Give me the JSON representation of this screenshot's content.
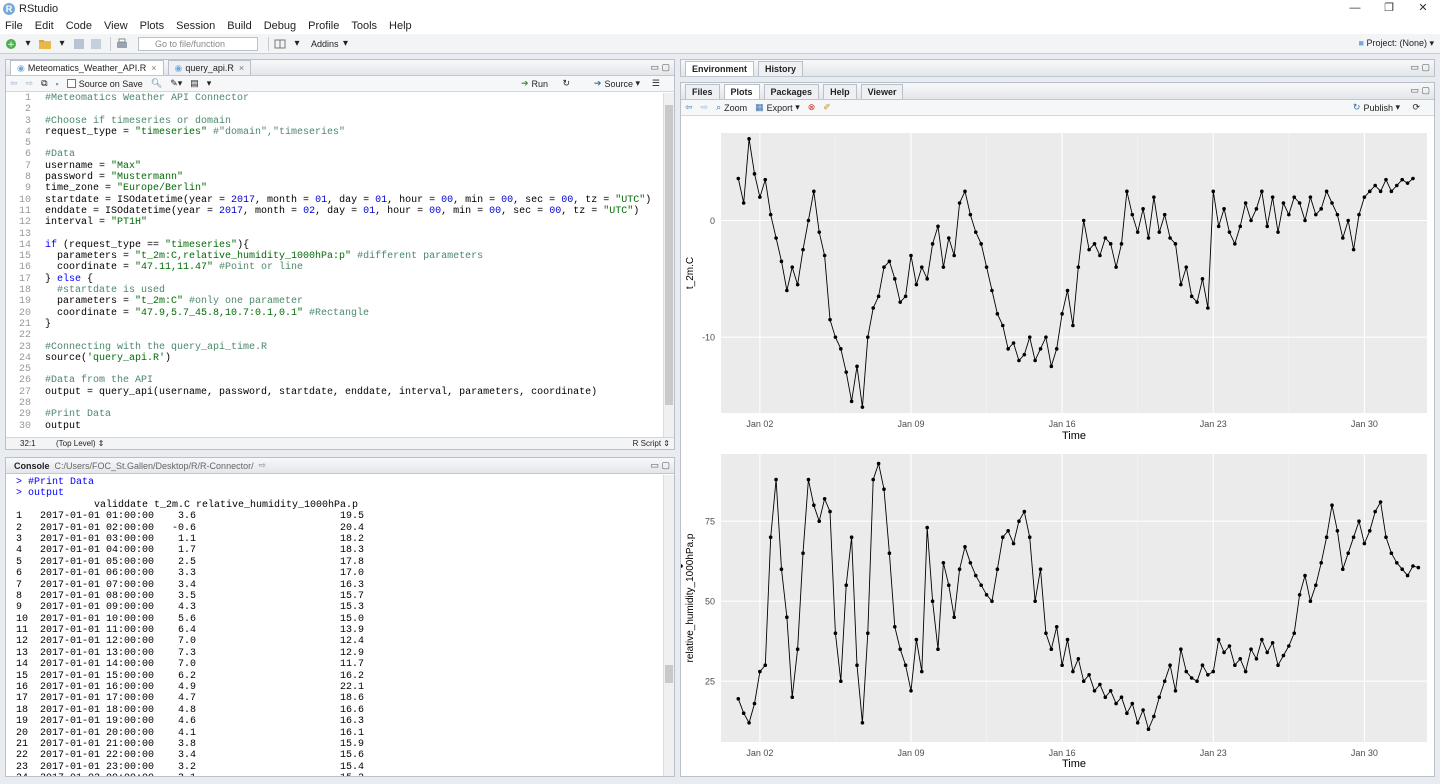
{
  "app": {
    "title": "RStudio",
    "icon_letter": "R"
  },
  "window_controls": {
    "minimize": "—",
    "maximize": "❐",
    "close": "✕"
  },
  "menu": [
    "File",
    "Edit",
    "Code",
    "View",
    "Plots",
    "Session",
    "Build",
    "Debug",
    "Profile",
    "Tools",
    "Help"
  ],
  "toolbar": {
    "goto_placeholder": "Go to file/function",
    "addins": "Addins",
    "project": "Project: (None)"
  },
  "editor": {
    "tabs": [
      "Meteomatics_Weather_API.R",
      "query_api.R"
    ],
    "source_on_save": "Source on Save",
    "run": "Run",
    "source": "Source",
    "status_pos": "32:1",
    "status_scope": "(Top Level)",
    "status_type": "R Script",
    "lines": [
      [
        [
          "c",
          "#Meteomatics Weather API Connector"
        ]
      ],
      [],
      [
        [
          "c",
          "#Choose if timeseries or domain"
        ]
      ],
      [
        [
          "p",
          "request_type = "
        ],
        [
          "s",
          "\"timeseries\""
        ],
        [
          "c",
          " #\"domain\",\"timeseries\""
        ]
      ],
      [],
      [
        [
          "c",
          "#Data"
        ]
      ],
      [
        [
          "p",
          "username = "
        ],
        [
          "s",
          "\"Max\""
        ]
      ],
      [
        [
          "p",
          "password = "
        ],
        [
          "s",
          "\"Mustermann\""
        ]
      ],
      [
        [
          "p",
          "time_zone = "
        ],
        [
          "s",
          "\"Europe/Berlin\""
        ]
      ],
      [
        [
          "p",
          "startdate = ISOdatetime(year = "
        ],
        [
          "n",
          "2017"
        ],
        [
          "p",
          ", month = "
        ],
        [
          "n",
          "01"
        ],
        [
          "p",
          ", day = "
        ],
        [
          "n",
          "01"
        ],
        [
          "p",
          ", hour = "
        ],
        [
          "n",
          "00"
        ],
        [
          "p",
          ", min = "
        ],
        [
          "n",
          "00"
        ],
        [
          "p",
          ", sec = "
        ],
        [
          "n",
          "00"
        ],
        [
          "p",
          ", tz = "
        ],
        [
          "s",
          "\"UTC\""
        ],
        [
          "p",
          ")"
        ]
      ],
      [
        [
          "p",
          "enddate = ISOdatetime(year = "
        ],
        [
          "n",
          "2017"
        ],
        [
          "p",
          ", month = "
        ],
        [
          "n",
          "02"
        ],
        [
          "p",
          ", day = "
        ],
        [
          "n",
          "01"
        ],
        [
          "p",
          ", hour = "
        ],
        [
          "n",
          "00"
        ],
        [
          "p",
          ", min = "
        ],
        [
          "n",
          "00"
        ],
        [
          "p",
          ", sec = "
        ],
        [
          "n",
          "00"
        ],
        [
          "p",
          ", tz = "
        ],
        [
          "s",
          "\"UTC\""
        ],
        [
          "p",
          ")"
        ]
      ],
      [
        [
          "p",
          "interval = "
        ],
        [
          "s",
          "\"PT1H\""
        ]
      ],
      [],
      [
        [
          "k",
          "if"
        ],
        [
          "p",
          " (request_type == "
        ],
        [
          "s",
          "\"timeseries\""
        ],
        [
          "p",
          "){"
        ]
      ],
      [
        [
          "p",
          "  parameters = "
        ],
        [
          "s",
          "\"t_2m:C,relative_humidity_1000hPa:p\""
        ],
        [
          "c",
          " #different parameters"
        ]
      ],
      [
        [
          "p",
          "  coordinate = "
        ],
        [
          "s",
          "\"47.11,11.47\""
        ],
        [
          "c",
          " #Point or line"
        ]
      ],
      [
        [
          "p",
          "} "
        ],
        [
          "k",
          "else"
        ],
        [
          "p",
          " {"
        ]
      ],
      [
        [
          "c",
          "  #startdate is used"
        ]
      ],
      [
        [
          "p",
          "  parameters = "
        ],
        [
          "s",
          "\"t_2m:C\""
        ],
        [
          "c",
          " #only one parameter"
        ]
      ],
      [
        [
          "p",
          "  coordinate = "
        ],
        [
          "s",
          "\"47.9,5.7_45.8,10.7:0.1,0.1\""
        ],
        [
          "c",
          " #Rectangle"
        ]
      ],
      [
        [
          "p",
          "}"
        ]
      ],
      [],
      [
        [
          "c",
          "#Connecting with the query_api_time.R"
        ]
      ],
      [
        [
          "p",
          "source("
        ],
        [
          "s",
          "'query_api.R'"
        ],
        [
          "p",
          ")"
        ]
      ],
      [],
      [
        [
          "c",
          "#Data from the API"
        ]
      ],
      [
        [
          "p",
          "output = query_api(username, password, startdate, enddate, interval, parameters, coordinate)"
        ]
      ],
      [],
      [
        [
          "c",
          "#Print Data"
        ]
      ],
      [
        [
          "p",
          "output"
        ]
      ]
    ]
  },
  "console": {
    "title": "Console",
    "path": "C:/Users/FOC_St.Gallen/Desktop/R/R-Connector/",
    "lines": [
      {
        "t": "> #Print Data",
        "cmd": true
      },
      {
        "t": "> output",
        "cmd": true
      },
      {
        "t": "             validdate t_2m.C relative_humidity_1000hPa.p"
      },
      {
        "t": "1   2017-01-01 01:00:00    3.6                        19.5"
      },
      {
        "t": "2   2017-01-01 02:00:00   -0.6                        20.4"
      },
      {
        "t": "3   2017-01-01 03:00:00    1.1                        18.2"
      },
      {
        "t": "4   2017-01-01 04:00:00    1.7                        18.3"
      },
      {
        "t": "5   2017-01-01 05:00:00    2.5                        17.8"
      },
      {
        "t": "6   2017-01-01 06:00:00    3.3                        17.0"
      },
      {
        "t": "7   2017-01-01 07:00:00    3.4                        16.3"
      },
      {
        "t": "8   2017-01-01 08:00:00    3.5                        15.7"
      },
      {
        "t": "9   2017-01-01 09:00:00    4.3                        15.3"
      },
      {
        "t": "10  2017-01-01 10:00:00    5.6                        15.0"
      },
      {
        "t": "11  2017-01-01 11:00:00    6.4                        13.9"
      },
      {
        "t": "12  2017-01-01 12:00:00    7.0                        12.4"
      },
      {
        "t": "13  2017-01-01 13:00:00    7.3                        12.9"
      },
      {
        "t": "14  2017-01-01 14:00:00    7.0                        11.7"
      },
      {
        "t": "15  2017-01-01 15:00:00    6.2                        16.2"
      },
      {
        "t": "16  2017-01-01 16:00:00    4.9                        22.1"
      },
      {
        "t": "17  2017-01-01 17:00:00    4.7                        18.6"
      },
      {
        "t": "18  2017-01-01 18:00:00    4.8                        16.6"
      },
      {
        "t": "19  2017-01-01 19:00:00    4.6                        16.3"
      },
      {
        "t": "20  2017-01-01 20:00:00    4.1                        16.1"
      },
      {
        "t": "21  2017-01-01 21:00:00    3.8                        15.9"
      },
      {
        "t": "22  2017-01-01 22:00:00    3.4                        15.6"
      },
      {
        "t": "23  2017-01-01 23:00:00    3.2                        15.4"
      },
      {
        "t": "24  2017-01-02 00:00:00    3.1                        15.2"
      }
    ]
  },
  "env_pane": {
    "tabs": [
      "Environment",
      "History"
    ]
  },
  "files_pane": {
    "tabs": [
      "Files",
      "Plots",
      "Packages",
      "Help",
      "Viewer"
    ],
    "active_tab": "Plots",
    "zoom": "Zoom",
    "export": "Export",
    "publish": "Publish"
  },
  "chart_data": [
    {
      "type": "line",
      "xlabel": "Time",
      "ylabel": "t_2m.C",
      "x_ticks": [
        "Jan 02",
        "Jan 09",
        "Jan 16",
        "Jan 23",
        "Jan 30"
      ],
      "y_ticks": [
        "-10",
        "0"
      ],
      "ylim": [
        -16.5,
        7.5
      ],
      "grid": true,
      "markers": "points",
      "series": [
        {
          "x_day_offsets": [
            0.0,
            0.25,
            0.5,
            0.75,
            1.0,
            1.25,
            1.5,
            1.75,
            2.0,
            2.25,
            2.5,
            2.75,
            3.0,
            3.25,
            3.5,
            3.75,
            4.0,
            4.25,
            4.5,
            4.75,
            5.0,
            5.25,
            5.5,
            5.75,
            6.0,
            6.25,
            6.5,
            6.75,
            7.0,
            7.25,
            7.5,
            7.75,
            8.0,
            8.25,
            8.5,
            8.75,
            9.0,
            9.25,
            9.5,
            9.75,
            10.0,
            10.25,
            10.5,
            10.75,
            11.0,
            11.25,
            11.5,
            11.75,
            12.0,
            12.25,
            12.5,
            12.75,
            13.0,
            13.25,
            13.5,
            13.75,
            14.0,
            14.25,
            14.5,
            14.75,
            15.0,
            15.25,
            15.5,
            15.75,
            16.0,
            16.25,
            16.5,
            16.75,
            17.0,
            17.25,
            17.5,
            17.75,
            18.0,
            18.25,
            18.5,
            18.75,
            19.0,
            19.25,
            19.5,
            19.75,
            20.0,
            20.25,
            20.5,
            20.75,
            21.0,
            21.25,
            21.5,
            21.75,
            22.0,
            22.25,
            22.5,
            22.75,
            23.0,
            23.25,
            23.5,
            23.75,
            24.0,
            24.25,
            24.5,
            24.75,
            25.0,
            25.25,
            25.5,
            25.75,
            26.0,
            26.25,
            26.5,
            26.75,
            27.0,
            27.25,
            27.5,
            27.75,
            28.0,
            28.25,
            28.5,
            28.75,
            29.0,
            29.25,
            29.5,
            29.75,
            30.0,
            30.25,
            30.5,
            30.75,
            31.0,
            31.25,
            31.5
          ],
          "values": [
            3.6,
            1.5,
            7.0,
            4.0,
            2.0,
            3.5,
            0.5,
            -1.5,
            -3.5,
            -6.0,
            -4.0,
            -5.5,
            -2.5,
            0.0,
            2.5,
            -1.0,
            -3.0,
            -8.5,
            -10.0,
            -11.0,
            -13.0,
            -15.5,
            -12.5,
            -16.0,
            -10.0,
            -7.5,
            -6.5,
            -4.0,
            -3.5,
            -5.0,
            -7.0,
            -6.5,
            -3.0,
            -5.5,
            -4.0,
            -5.0,
            -2.0,
            -0.5,
            -4.0,
            -1.5,
            -3.0,
            1.5,
            2.5,
            0.5,
            -1.0,
            -2.0,
            -4.0,
            -6.0,
            -8.0,
            -9.0,
            -11.0,
            -10.5,
            -12.0,
            -11.5,
            -10.0,
            -12.0,
            -11.0,
            -10.0,
            -12.5,
            -11.0,
            -8.0,
            -6.0,
            -9.0,
            -4.0,
            0.0,
            -2.5,
            -2.0,
            -3.0,
            -1.5,
            -2.0,
            -4.0,
            -2.0,
            2.5,
            0.5,
            -1.0,
            1.0,
            -1.5,
            2.0,
            -1.0,
            0.5,
            -1.5,
            -2.0,
            -5.5,
            -4.0,
            -6.5,
            -7.0,
            -5.0,
            -7.5,
            2.5,
            -0.5,
            1.0,
            -1.0,
            -2.0,
            -0.5,
            1.5,
            0.0,
            1.0,
            2.5,
            -0.5,
            2.0,
            -1.0,
            1.5,
            0.5,
            2.0,
            1.5,
            0.0,
            2.0,
            0.5,
            1.0,
            2.5,
            1.5,
            0.5,
            -1.5,
            0.0,
            -2.5,
            0.5,
            2.0,
            2.5,
            3.0,
            2.5,
            3.5,
            2.5,
            3.0,
            3.5,
            3.2,
            3.6
          ]
        }
      ]
    },
    {
      "type": "line",
      "xlabel": "Time",
      "ylabel": "relative_humidity_1000hPa.p",
      "x_ticks": [
        "Jan 02",
        "Jan 09",
        "Jan 16",
        "Jan 23",
        "Jan 30"
      ],
      "y_ticks": [
        "25",
        "50",
        "75"
      ],
      "ylim": [
        6,
        96
      ],
      "grid": true,
      "markers": "points",
      "series": [
        {
          "x_day_offsets": [
            0.0,
            0.25,
            0.5,
            0.75,
            1.0,
            1.25,
            1.5,
            1.75,
            2.0,
            2.25,
            2.5,
            2.75,
            3.0,
            3.25,
            3.5,
            3.75,
            4.0,
            4.25,
            4.5,
            4.75,
            5.0,
            5.25,
            5.5,
            5.75,
            6.0,
            6.25,
            6.5,
            6.75,
            7.0,
            7.25,
            7.5,
            7.75,
            8.0,
            8.25,
            8.5,
            8.75,
            9.0,
            9.25,
            9.5,
            9.75,
            10.0,
            10.25,
            10.5,
            10.75,
            11.0,
            11.25,
            11.5,
            11.75,
            12.0,
            12.25,
            12.5,
            12.75,
            13.0,
            13.25,
            13.5,
            13.75,
            14.0,
            14.25,
            14.5,
            14.75,
            15.0,
            15.25,
            15.5,
            15.75,
            16.0,
            16.25,
            16.5,
            16.75,
            17.0,
            17.25,
            17.5,
            17.75,
            18.0,
            18.25,
            18.5,
            18.75,
            19.0,
            19.25,
            19.5,
            19.75,
            20.0,
            20.25,
            20.5,
            20.75,
            21.0,
            21.25,
            21.5,
            21.75,
            22.0,
            22.25,
            22.5,
            22.75,
            23.0,
            23.25,
            23.5,
            23.75,
            24.0,
            24.25,
            24.5,
            24.75,
            25.0,
            25.25,
            25.5,
            25.75,
            26.0,
            26.25,
            26.5,
            26.75,
            27.0,
            27.25,
            27.5,
            27.75,
            28.0,
            28.25,
            28.5,
            28.75,
            29.0,
            29.25,
            29.5,
            29.75,
            30.0,
            30.25,
            30.5,
            30.75,
            31.0,
            31.25,
            31.5
          ],
          "values": [
            19.5,
            15.0,
            12.0,
            18.0,
            28.0,
            30.0,
            70.0,
            88.0,
            60.0,
            45.0,
            20.0,
            35.0,
            65.0,
            88.0,
            80.0,
            75.0,
            82.0,
            78.0,
            40.0,
            25.0,
            55.0,
            70.0,
            30.0,
            12.0,
            40.0,
            88.0,
            93.0,
            85.0,
            65.0,
            42.0,
            35.0,
            30.0,
            22.0,
            38.0,
            28.0,
            73.0,
            50.0,
            35.0,
            62.0,
            55.0,
            45.0,
            60.0,
            67.0,
            62.0,
            58.0,
            55.0,
            52.0,
            50.0,
            60.0,
            70.0,
            72.0,
            68.0,
            75.0,
            78.0,
            70.0,
            50.0,
            60.0,
            40.0,
            35.0,
            42.0,
            30.0,
            38.0,
            28.0,
            32.0,
            25.0,
            27.0,
            22.0,
            24.0,
            20.0,
            22.0,
            18.0,
            20.0,
            15.0,
            18.0,
            12.0,
            16.0,
            10.0,
            14.0,
            20.0,
            25.0,
            30.0,
            22.0,
            35.0,
            28.0,
            26.0,
            25.0,
            30.0,
            27.0,
            28.0,
            38.0,
            34.0,
            36.0,
            30.0,
            32.0,
            28.0,
            35.0,
            32.0,
            38.0,
            34.0,
            37.0,
            30.0,
            33.0,
            36.0,
            40.0,
            52.0,
            58.0,
            50.0,
            55.0,
            62.0,
            70.0,
            80.0,
            72.0,
            60.0,
            65.0,
            70.0,
            75.0,
            68.0,
            72.0,
            78.0,
            81.0,
            70.0,
            65.0,
            62.0,
            60.0,
            58.0,
            61.0,
            60.5,
            61.0
          ]
        }
      ]
    }
  ]
}
